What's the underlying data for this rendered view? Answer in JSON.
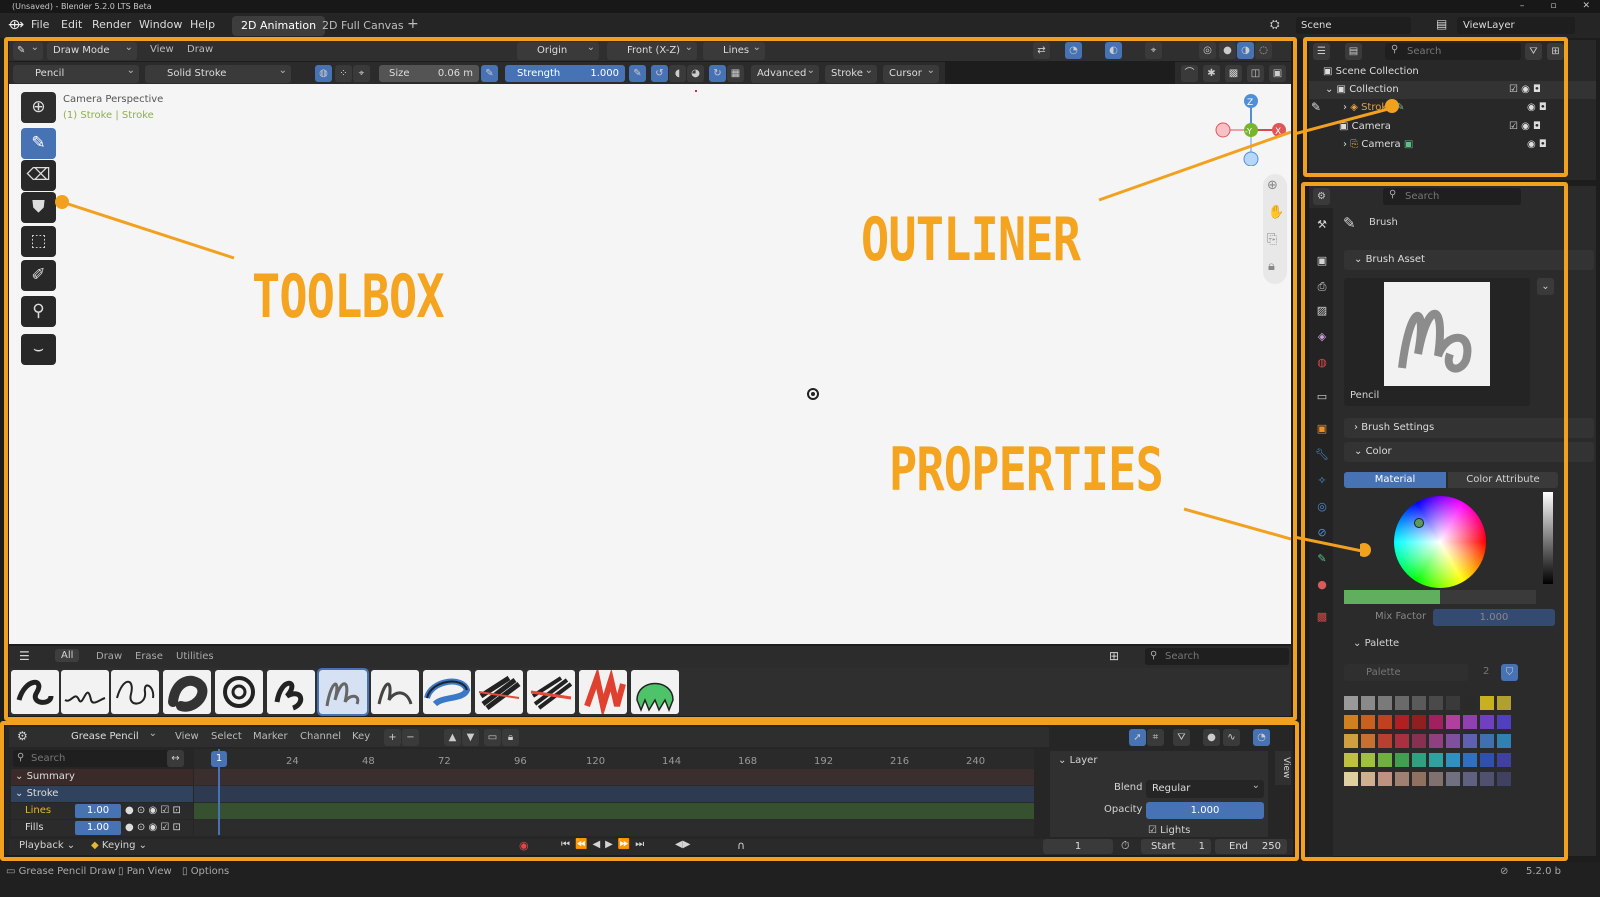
{
  "titlebar": {
    "title": "(Unsaved) - Blender 5.2.0 LTS Beta",
    "controls": [
      "–",
      "▫",
      "✕"
    ]
  },
  "menu": {
    "items": [
      "File",
      "Edit",
      "Render",
      "Window",
      "Help"
    ]
  },
  "workspaces": {
    "tabs": [
      "2D Animation",
      "2D Full Canvas"
    ],
    "add": "+"
  },
  "scene": {
    "label": "Scene",
    "viewlayer": "ViewLayer"
  },
  "viewport_header": {
    "mode": "Draw Mode",
    "view": "View",
    "draw": "Draw",
    "pivot": "Origin",
    "orientation": "Front (X-Z)",
    "stroke_placement": "Lines",
    "tool": "Pencil",
    "stroke_type": "Solid Stroke",
    "size_label": "Size",
    "size_value": "0.06 m",
    "strength_label": "Strength",
    "strength_value": "1.000",
    "advanced": "Advanced",
    "stroke": "Stroke",
    "cursor": "Cursor"
  },
  "viewport": {
    "camera_label": "Camera Perspective",
    "context": "(1) Stroke | Stroke",
    "gizmo": {
      "z": "Z",
      "y": "-Y",
      "x": "X"
    }
  },
  "callouts": {
    "toolbox": "TOOLBOX",
    "outliner": "OUTLINER",
    "properties": "PROPERTIES"
  },
  "asset_shelf": {
    "tabs": [
      "All",
      "Draw",
      "Erase",
      "Utilities"
    ],
    "search_placeholder": "Search"
  },
  "timeline": {
    "editor": "Grease Pencil",
    "menus": [
      "View",
      "Select",
      "Marker",
      "Channel",
      "Key"
    ],
    "search_placeholder": "Search",
    "current_frame": "1",
    "ticks": [
      "24",
      "48",
      "72",
      "96",
      "120",
      "144",
      "168",
      "192",
      "216",
      "240"
    ],
    "channels": {
      "summary": "Summary",
      "object": "Stroke",
      "layers": [
        {
          "name": "Lines",
          "value": "1.00"
        },
        {
          "name": "Fills",
          "value": "1.00"
        }
      ]
    },
    "layer_panel": {
      "title": "Layer",
      "blend_label": "Blend",
      "blend_value": "Regular",
      "opacity_label": "Opacity",
      "opacity_value": "1.000",
      "lights": "Lights",
      "side_tab": "View"
    },
    "playback": "Playback",
    "keying": "Keying",
    "frame": "1",
    "start_label": "Start",
    "start": "1",
    "end_label": "End",
    "end": "250"
  },
  "outliner": {
    "search_placeholder": "Search",
    "scene_collection": "Scene Collection",
    "collection": "Collection",
    "stroke": "Stroke",
    "camera_coll": "Camera",
    "camera_obj": "Camera"
  },
  "properties": {
    "search_placeholder": "Search",
    "brush_label": "Brush",
    "brush_asset": "Brush Asset",
    "brush_name": "Pencil",
    "brush_settings": "Brush Settings",
    "color": "Color",
    "tab_material": "Material",
    "tab_attr": "Color Attribute",
    "mix_label": "Mix Factor",
    "mix_value": "1.000",
    "palette_header": "Palette",
    "palette_name": "Palette",
    "palette_users": "2"
  },
  "statusbar": {
    "items": [
      "Grease Pencil Draw",
      "Pan View",
      "Options"
    ],
    "version": "5.2.0 b"
  }
}
